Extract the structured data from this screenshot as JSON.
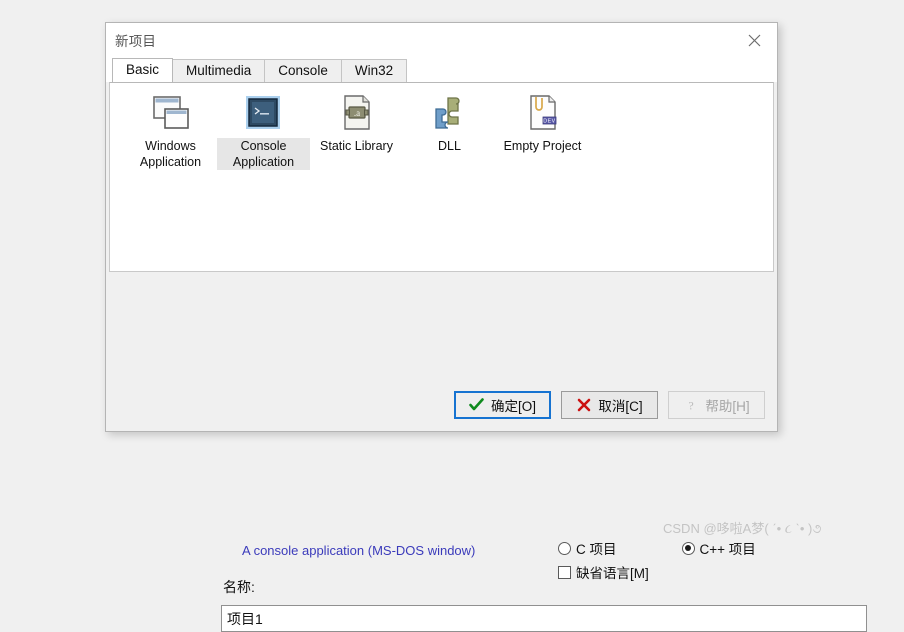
{
  "dialog": {
    "title": "新项目",
    "close_icon": "close-icon"
  },
  "tabs": [
    {
      "label": "Basic",
      "active": true
    },
    {
      "label": "Multimedia",
      "active": false
    },
    {
      "label": "Console",
      "active": false
    },
    {
      "label": "Win32",
      "active": false
    }
  ],
  "project_types": [
    {
      "label": "Windows\nApplication",
      "icon": "windows-application-icon",
      "selected": false
    },
    {
      "label": "Console\nApplication",
      "icon": "console-application-icon",
      "selected": true
    },
    {
      "label": "Static Library",
      "icon": "static-library-icon",
      "selected": false
    },
    {
      "label": "DLL",
      "icon": "dll-icon",
      "selected": false
    },
    {
      "label": "Empty Project",
      "icon": "empty-project-icon",
      "selected": false
    }
  ],
  "description": "A console application (MS-DOS window)",
  "options": {
    "c_project": {
      "label": "C 项目",
      "checked": false
    },
    "cpp_project": {
      "label": "C++ 项目",
      "checked": true
    },
    "default_language": {
      "label": "缺省语言[M]",
      "checked": false
    }
  },
  "name_field": {
    "label": "名称:",
    "value": "项目1",
    "placeholder": ""
  },
  "buttons": {
    "ok": {
      "label": "确定[O]",
      "icon": "check-icon",
      "focused": true,
      "disabled": false
    },
    "cancel": {
      "label": "取消[C]",
      "icon": "cross-icon",
      "focused": false,
      "disabled": false
    },
    "help": {
      "label": "帮助[H]",
      "icon": "question-icon",
      "focused": false,
      "disabled": true
    }
  },
  "watermark": "CSDN @哆啦A梦( ˊ• ૮ ˋ• )૭",
  "colors": {
    "accent": "#1673d1",
    "description_text": "#3b3bbb",
    "ok_check": "#0f8a1e",
    "cancel_cross": "#cc1111",
    "page_background": "#f0f0f0"
  }
}
